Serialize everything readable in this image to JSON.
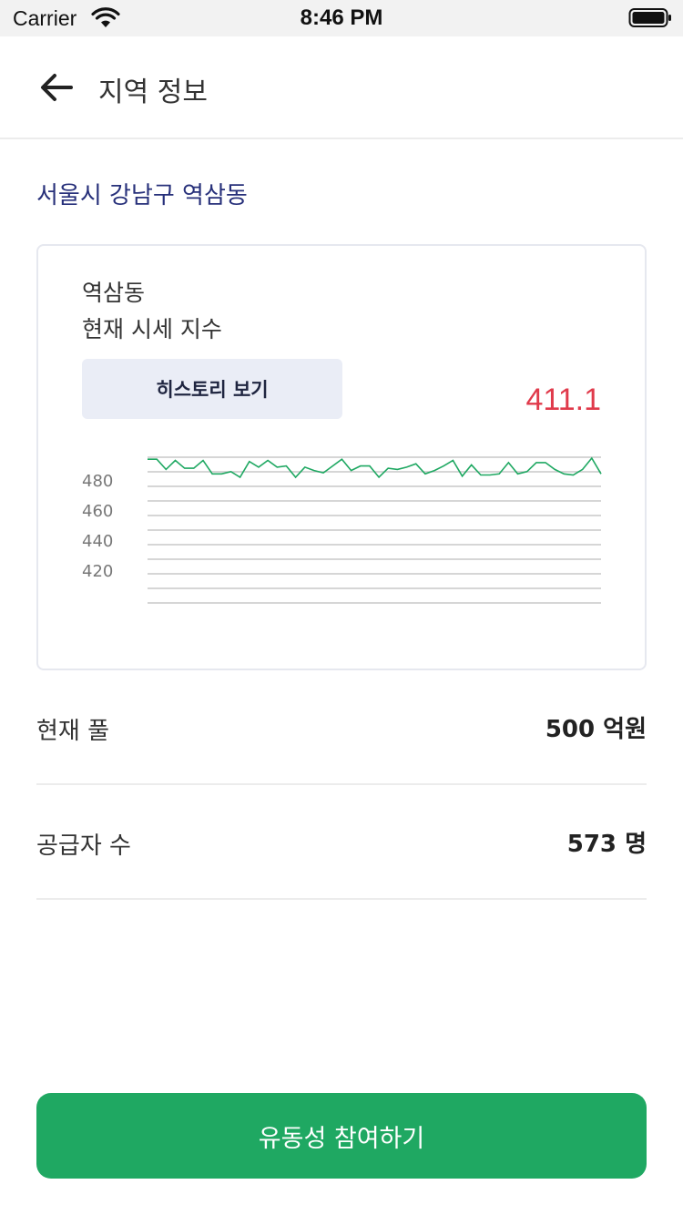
{
  "status_bar": {
    "carrier": "Carrier",
    "time": "8:46 PM"
  },
  "nav": {
    "title": "지역 정보"
  },
  "region": "서울시 강남구 역삼동",
  "card": {
    "line1": "역삼동",
    "line2": "현재 시세 지수",
    "history_button": "히스토리 보기",
    "current_value": "411.1"
  },
  "chart_data": {
    "type": "line",
    "y_ticks": [
      "480",
      "460",
      "440",
      "420"
    ],
    "grid": true,
    "series": [
      {
        "color": "#1fa862",
        "values": [
          500,
          500,
          491,
          499,
          492,
          492,
          499,
          487,
          487,
          489,
          484,
          498,
          493,
          499,
          493,
          494,
          484,
          493,
          490,
          488,
          494,
          500,
          490,
          494,
          494,
          484,
          492,
          491,
          493,
          496,
          487,
          490,
          494,
          499,
          485,
          495,
          486,
          486,
          487,
          497,
          487,
          489,
          497,
          497,
          491,
          487,
          486,
          491,
          501,
          487
        ]
      }
    ]
  },
  "rows": [
    {
      "label": "현재 풀",
      "value": "500 억원"
    },
    {
      "label": "공급자 수",
      "value": "573 명"
    }
  ],
  "cta_label": "유동성 참여하기",
  "colors": {
    "accent": "#1fa862",
    "price": "#e03a4b",
    "region": "#27307a"
  }
}
